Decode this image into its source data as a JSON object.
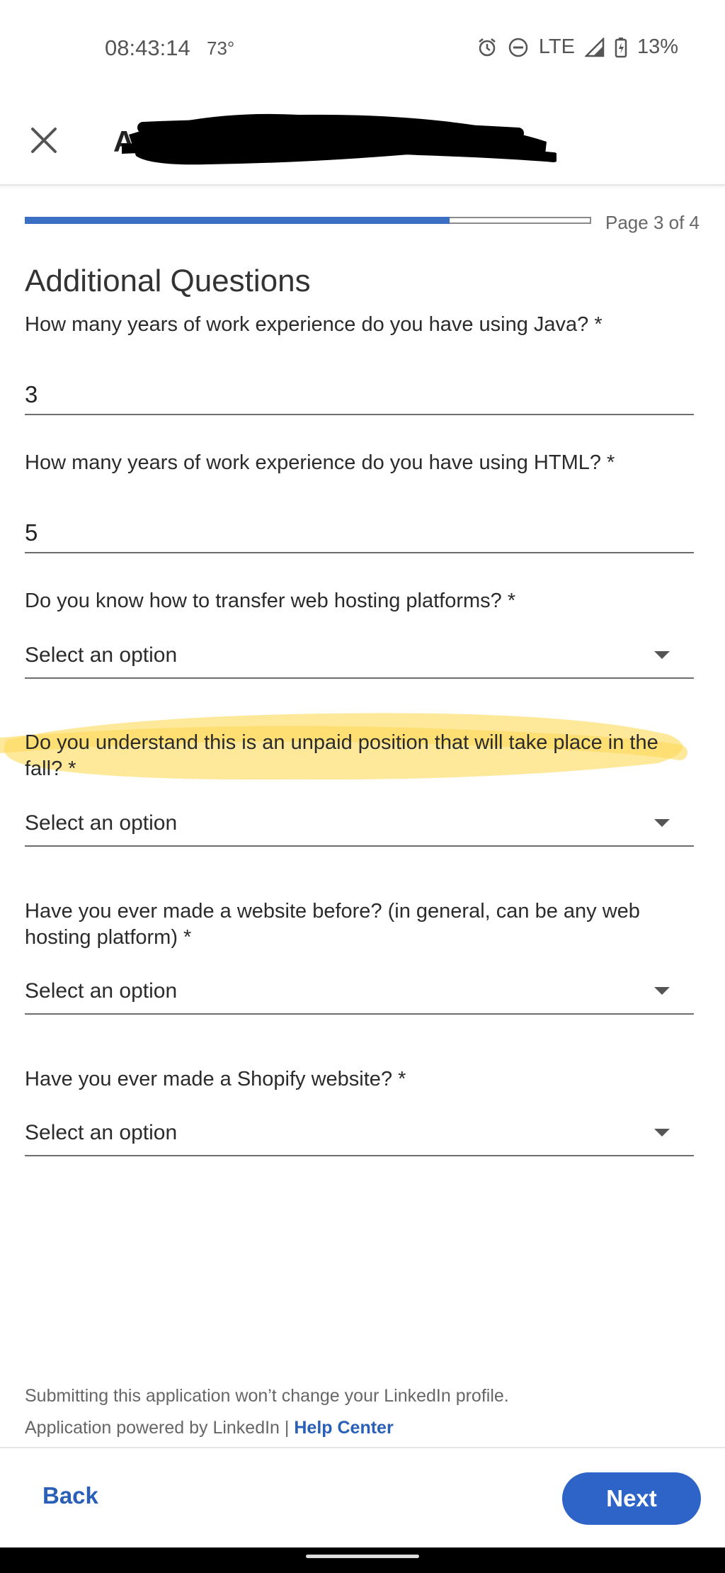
{
  "status_bar": {
    "time": "08:43:14",
    "temperature": "73°",
    "network": "LTE",
    "battery": "13%"
  },
  "header": {
    "title_visible": "A",
    "close_icon": "close-icon"
  },
  "progress": {
    "fraction": 0.75,
    "page_label": "Page 3 of 4"
  },
  "form": {
    "section_title": "Additional Questions",
    "questions": [
      {
        "label": "How many years of work experience do you have using Java? *",
        "value": "3"
      },
      {
        "label": "How many years of work experience do you have using HTML? *",
        "value": "5"
      },
      {
        "label": "Do you know how to transfer web hosting platforms? *",
        "value": "Select an option"
      },
      {
        "label": "Do you understand this is an unpaid position that will take place in the fall? *",
        "value": "Select an option"
      },
      {
        "label": "Have you ever made a website before? (in general, can be any web hosting platform) *",
        "value": "Select an option"
      },
      {
        "label": "Have you ever made a Shopify website? *",
        "value": "Select an option"
      }
    ]
  },
  "footer": {
    "note": "Submitting this application won’t change your LinkedIn profile.",
    "powered_by": "Application powered by LinkedIn | ",
    "help_center": "Help Center"
  },
  "actions": {
    "back_label": "Back",
    "next_label": "Next"
  },
  "colors": {
    "accent": "#2e63c7",
    "highlight": "#fde27a"
  }
}
